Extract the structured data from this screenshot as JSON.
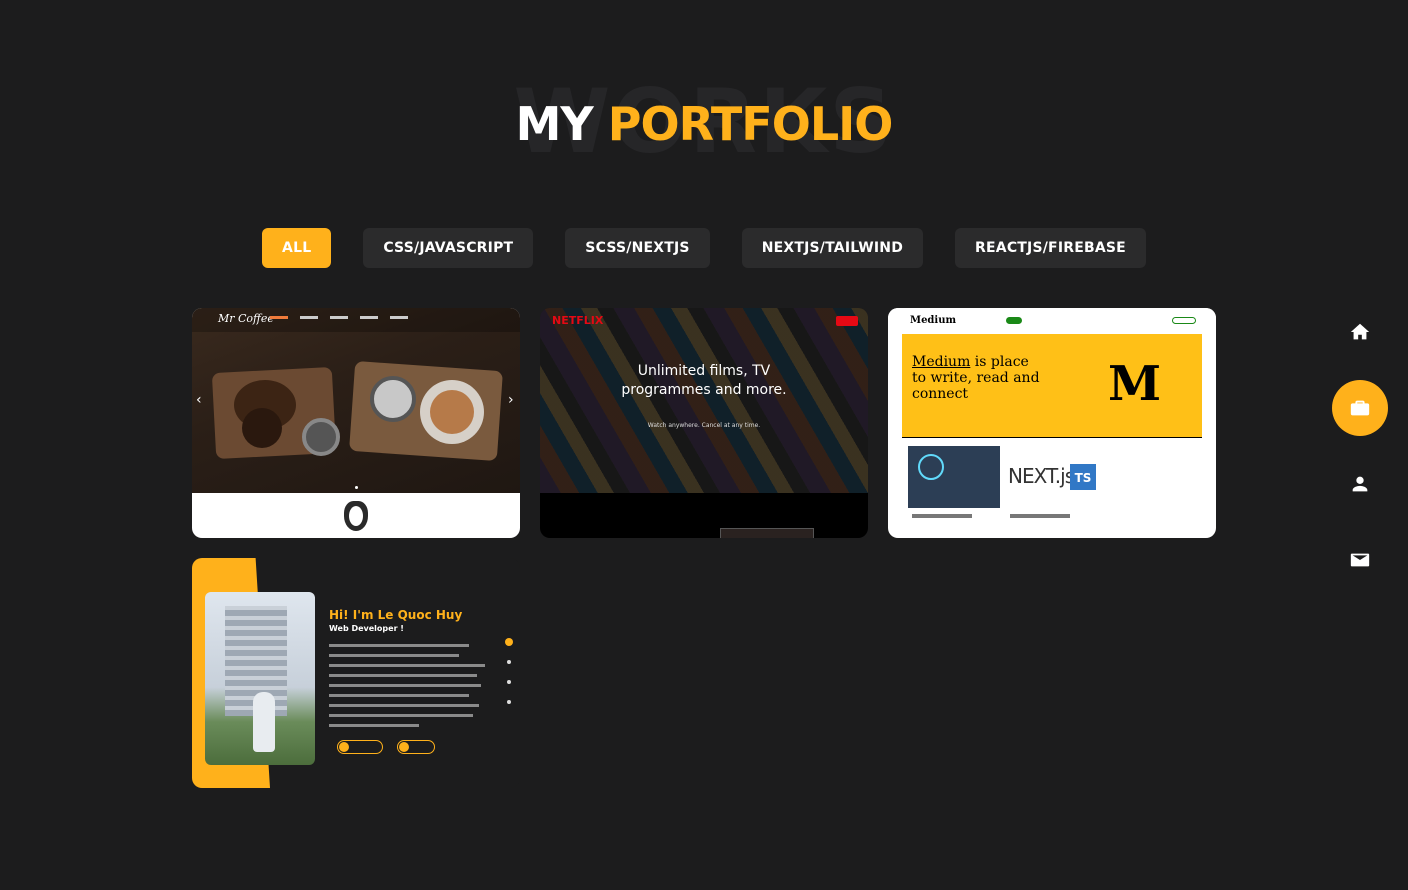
{
  "heading": {
    "background_word": "WORKS",
    "title_white": "MY",
    "title_accent": "PORTFOLIO"
  },
  "colors": {
    "accent": "#ffb11b",
    "background": "#1c1c1d",
    "filter_bg": "#2b2b2c"
  },
  "filters": [
    {
      "label": "ALL",
      "active": true
    },
    {
      "label": "CSS/JAVASCRIPT",
      "active": false
    },
    {
      "label": "SCSS/NEXTJS",
      "active": false
    },
    {
      "label": "NEXTJS/TAILWIND",
      "active": false
    },
    {
      "label": "REACTJS/FIREBASE",
      "active": false
    }
  ],
  "projects": [
    {
      "name": "coffee-site",
      "logo_text": "Mr Coffee"
    },
    {
      "name": "netflix-clone",
      "logo_text": "NETFLIX",
      "headline": "Unlimited films, TV programmes and more.",
      "subline": "Watch anywhere. Cancel at any time."
    },
    {
      "name": "medium-clone",
      "logo_text": "Medium",
      "headline_underlined": "Medium",
      "headline_rest": " is place to write, read and connect",
      "big_letter": "M",
      "next_logo": "NEXT.js",
      "ts_badge": "TS"
    },
    {
      "name": "personal-portfolio",
      "greeting": "Hi! I'm Le Quoc Huy",
      "role": "Web Developer !"
    }
  ],
  "sidenav": [
    {
      "icon": "home-icon",
      "active": false
    },
    {
      "icon": "briefcase-icon",
      "active": true
    },
    {
      "icon": "person-icon",
      "active": false
    },
    {
      "icon": "mail-icon",
      "active": false
    }
  ]
}
